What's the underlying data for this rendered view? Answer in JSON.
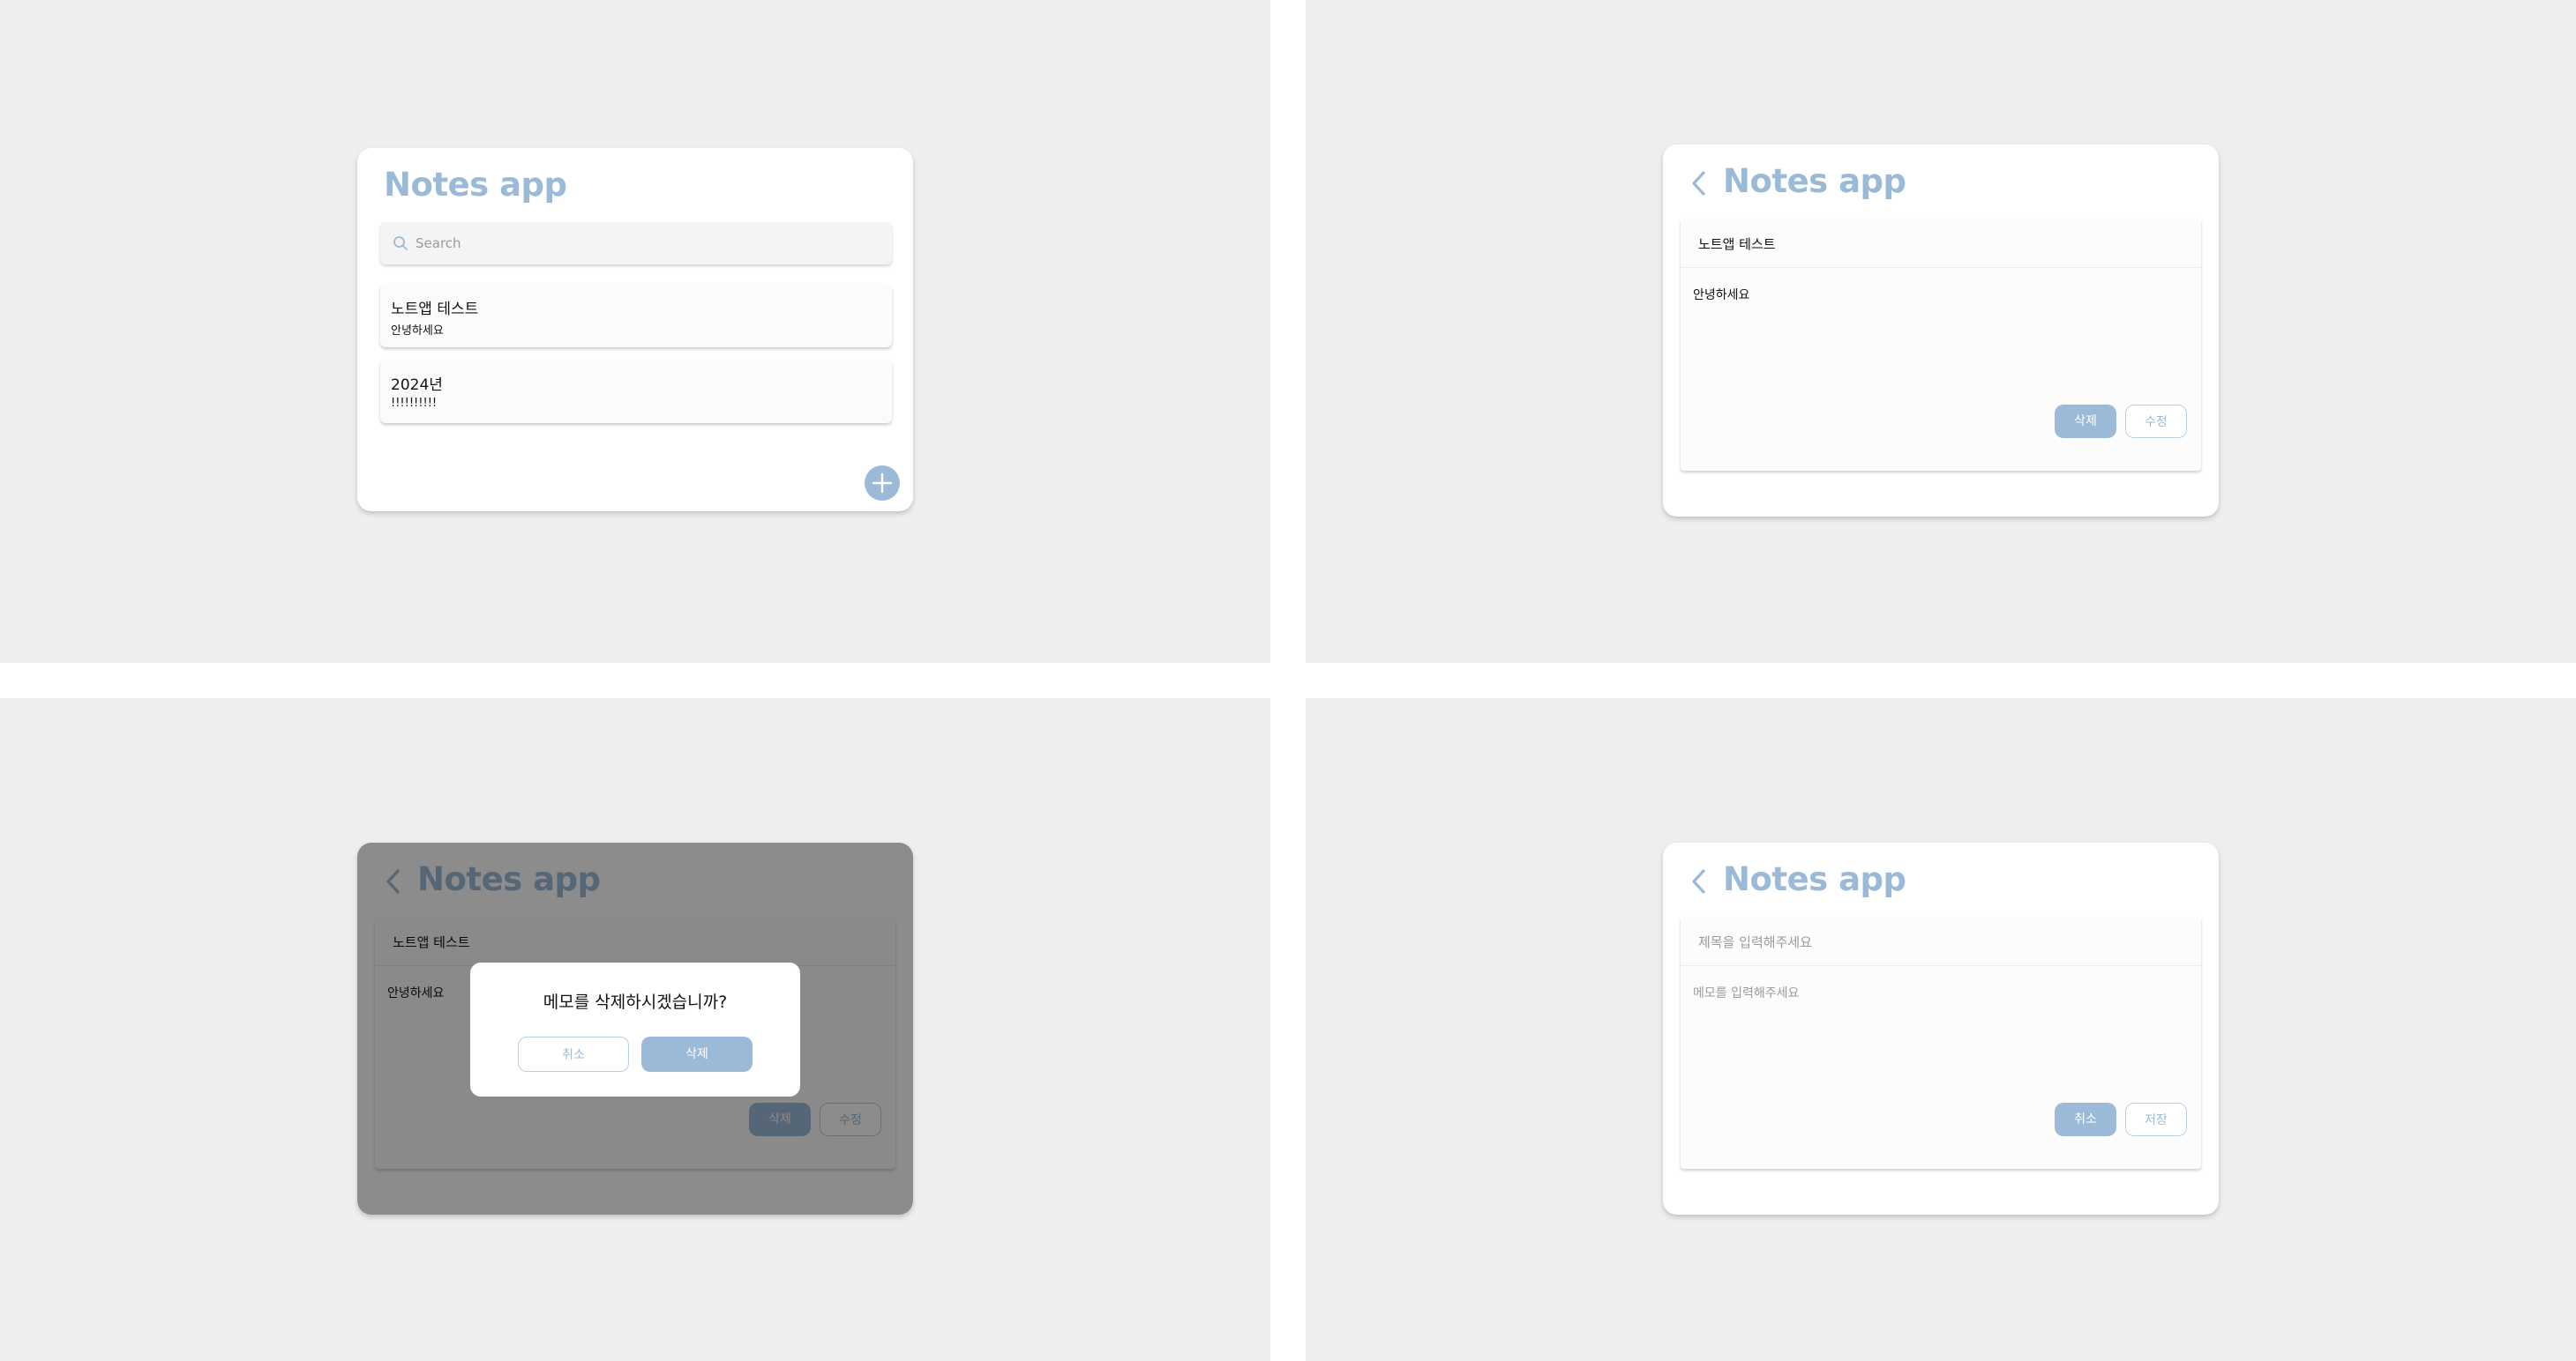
{
  "app": {
    "title": "Notes app"
  },
  "list_screen": {
    "search_placeholder": "Search",
    "notes": [
      {
        "title": "노트앱 테스트",
        "body": "안녕하세요"
      },
      {
        "title": "2024년",
        "body": "!!!!!!!!!!"
      }
    ]
  },
  "detail_screen": {
    "title": "노트앱 테스트",
    "body": "안녕하세요",
    "delete_label": "삭제",
    "edit_label": "수정"
  },
  "confirm_dialog": {
    "message": "메모를 삭제하시겠습니까?",
    "cancel_label": "취소",
    "delete_label": "삭제"
  },
  "create_screen": {
    "title_placeholder": "제목을 입력해주세요",
    "body_placeholder": "메모를 입력해주세요",
    "cancel_label": "취소",
    "save_label": "저장"
  },
  "colors": {
    "accent": "#9bbad8",
    "background": "#eeeeee"
  }
}
